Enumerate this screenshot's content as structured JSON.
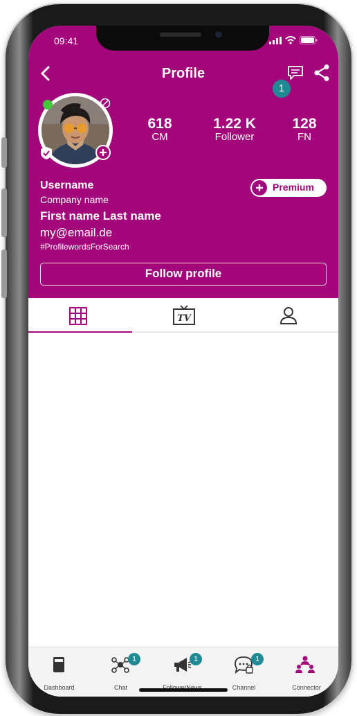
{
  "status_bar": {
    "time": "09:41"
  },
  "header": {
    "title": "Profile",
    "notification_count": "1"
  },
  "stats": [
    {
      "value": "618",
      "label": "CM"
    },
    {
      "value": "1.22 K",
      "label": "Follower"
    },
    {
      "value": "128",
      "label": "FN"
    }
  ],
  "profile": {
    "username": "Username",
    "company": "Company name",
    "full_name": "First name Last name",
    "email": "my@email.de",
    "tags": "#ProfilewordsForSearch",
    "premium_label": "Premium",
    "follow_label": "Follow profile"
  },
  "tabs": [
    {
      "icon": "grid-icon"
    },
    {
      "icon": "tv-icon"
    },
    {
      "icon": "person-icon"
    }
  ],
  "bottom_nav": [
    {
      "label": "Dashboard",
      "icon": "dashboard-icon",
      "badge": ""
    },
    {
      "label": "Chat",
      "icon": "chat-network-icon",
      "badge": "1"
    },
    {
      "label": "FollowerNews",
      "icon": "megaphone-icon",
      "badge": "1"
    },
    {
      "label": "Channel",
      "icon": "channel-icon",
      "badge": "1"
    },
    {
      "label": "Connector",
      "icon": "connector-icon",
      "badge": ""
    }
  ],
  "colors": {
    "accent": "#a3067a",
    "badge": "#1f8a94",
    "online": "#44c53b"
  }
}
